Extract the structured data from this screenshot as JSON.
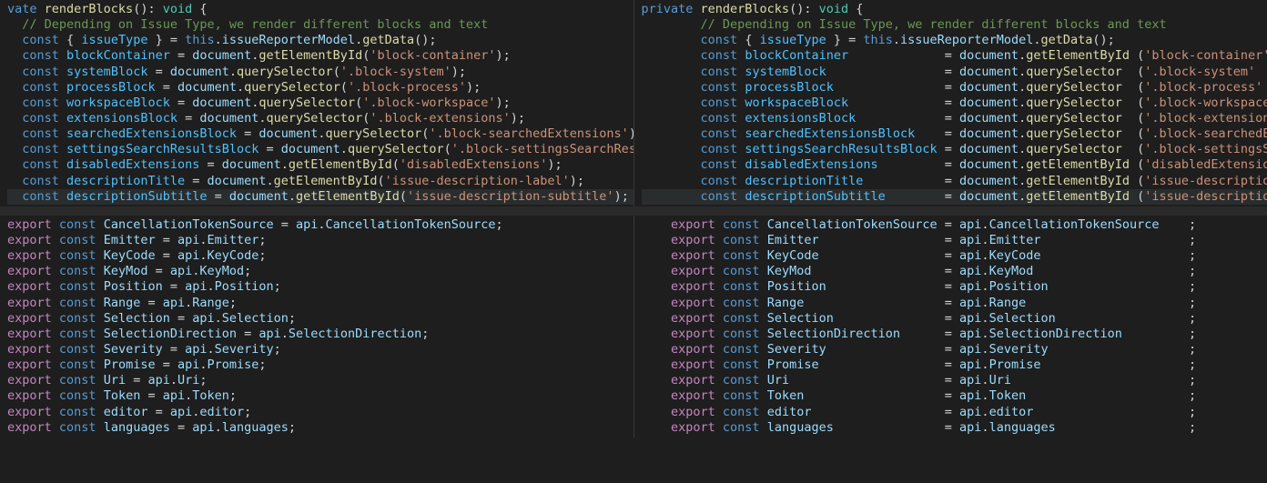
{
  "theme": {
    "background": "#1e1e1e",
    "separator": "#2a2a2a",
    "keyword": "#569cd6",
    "control": "#c586c0",
    "type": "#4ec9b0",
    "func": "#dcdcaa",
    "ident": "#9cdcfe",
    "var": "#4fc1ff",
    "string": "#ce9178",
    "punct": "#d4d4d4",
    "comment": "#6a9955"
  },
  "text": {
    "private": "vate",
    "private_full": "private",
    "fn_name": "renderBlocks",
    "void": "void",
    "const": "const",
    "this": "this",
    "export": "export",
    "comment": "// Depending on Issue Type, we render different blocks and text",
    "issueType": "issueType",
    "model": "issueReporterModel",
    "getData": "getData",
    "document": "document",
    "getElementById": "getElementById",
    "querySelector": "querySelector",
    "api": "api"
  },
  "topLeftIndent": "  ",
  "topRightIndent": "        ",
  "block": {
    "decls": [
      {
        "name": "blockContainer",
        "fn": "getElementById",
        "arg": "'block-container'"
      },
      {
        "name": "systemBlock",
        "fn": "querySelector",
        "arg": "'.block-system'"
      },
      {
        "name": "processBlock",
        "fn": "querySelector",
        "arg": "'.block-process'"
      },
      {
        "name": "workspaceBlock",
        "fn": "querySelector",
        "arg": "'.block-workspace'"
      },
      {
        "name": "extensionsBlock",
        "fn": "querySelector",
        "arg": "'.block-extensions'"
      },
      {
        "name": "searchedExtensionsBlock",
        "fn": "querySelector",
        "arg": "'.block-searchedExtensions'"
      },
      {
        "name": "settingsSearchResultsBlock",
        "fn": "querySelector",
        "arg": "'.block-settingsSearchResults'"
      },
      {
        "name": "disabledExtensions",
        "fn": "getElementById",
        "arg": "'disabledExtensions'"
      },
      {
        "name": "descriptionTitle",
        "fn": "getElementById",
        "arg": "'issue-description-label'"
      },
      {
        "name": "descriptionSubtitle",
        "fn": "getElementById",
        "arg": "'issue-description-subtitle'"
      }
    ],
    "name_pad": 26,
    "fn_pad_right": 15
  },
  "bottomLeftIndent": "",
  "bottomRightIndent": "    ",
  "exports": {
    "decls": [
      {
        "name": "CancellationTokenSource",
        "rhs": "CancellationTokenSource"
      },
      {
        "name": "Emitter",
        "rhs": "Emitter"
      },
      {
        "name": "KeyCode",
        "rhs": "KeyCode"
      },
      {
        "name": "KeyMod",
        "rhs": "KeyMod"
      },
      {
        "name": "Position",
        "rhs": "Position"
      },
      {
        "name": "Range",
        "rhs": "Range"
      },
      {
        "name": "Selection",
        "rhs": "Selection"
      },
      {
        "name": "SelectionDirection",
        "rhs": "SelectionDirection"
      },
      {
        "name": "Severity",
        "rhs": "Severity"
      },
      {
        "name": "Promise",
        "rhs": "Promise"
      },
      {
        "name": "Uri",
        "rhs": "Uri"
      },
      {
        "name": "Token",
        "rhs": "Token"
      },
      {
        "name": "editor",
        "rhs": "editor"
      },
      {
        "name": "languages",
        "rhs": "languages"
      }
    ],
    "name_pad": 23,
    "rhs_pad": 27
  }
}
